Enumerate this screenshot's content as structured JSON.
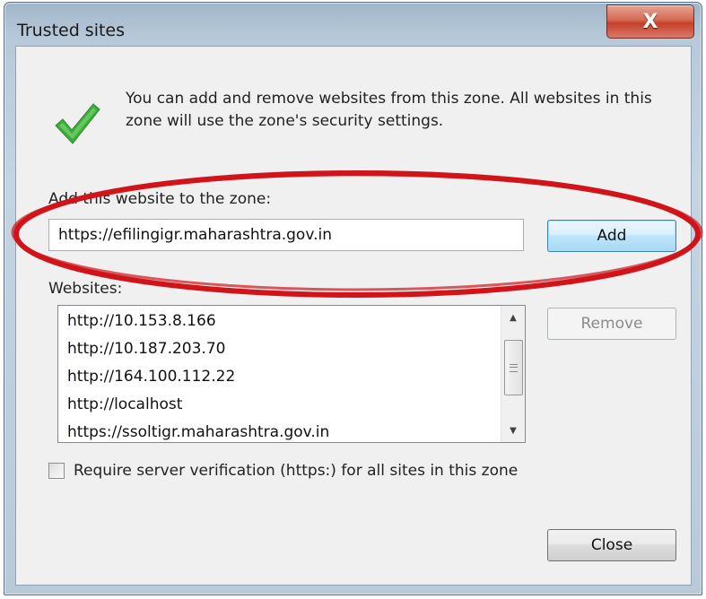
{
  "window": {
    "title": "Trusted sites",
    "close_glyph": "X"
  },
  "intro": {
    "text": "You can add and remove websites from this zone. All websites in this zone will use the zone's security settings.",
    "icon": "green-check-icon"
  },
  "add_section": {
    "label": "Add this website to the zone:",
    "input_value": "https://efilingigr.maharashtra.gov.in",
    "add_button": "Add"
  },
  "websites": {
    "label": "Websites:",
    "items": [
      "http://10.153.8.166",
      "http://10.187.203.70",
      "http://164.100.112.22",
      "http://localhost",
      "https://ssoltigr.maharashtra.gov.in"
    ],
    "remove_button": "Remove"
  },
  "require_verification": {
    "label": "Require server verification (https:) for all sites in this zone",
    "checked": false
  },
  "footer": {
    "close_button": "Close"
  },
  "colors": {
    "annotation": "#d0141a",
    "check_green": "#3fae3a",
    "default_button_border": "#3c7fb1"
  }
}
